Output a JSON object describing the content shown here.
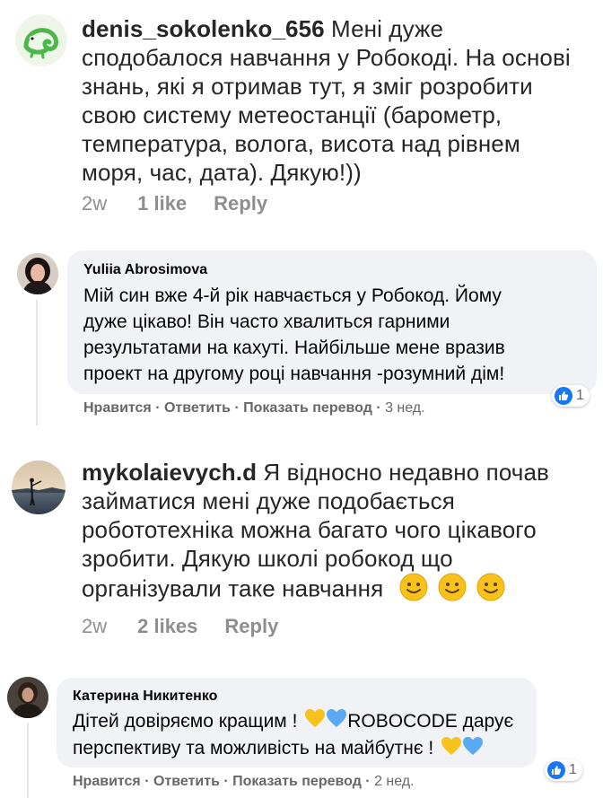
{
  "comments": [
    {
      "username": "denis_sokolenko_656",
      "text_lines": [
        "Мені дуже",
        "сподобалося навчання у Робокоді. На основі",
        "знань, які я отримав тут, я зміг розробити",
        "свою систему метеостанції (барометр,",
        "температура, волога, висота над рівнем",
        "моря, час, дата). Дякую!))"
      ],
      "time": "2w",
      "likes": "1 like",
      "reply": "Reply"
    },
    {
      "name": "Yuliia Abrosimova",
      "text_lines": [
        "Мій син вже 4-й рік навчається у Робокод. Йому",
        "дуже цікаво! Він часто хвалиться гарними",
        "результатами на кахуті. Найбільше мене вразив",
        "проект на другому році навчання -розумний дім!"
      ],
      "actions": "Нравится · Ответить · Показать перевод · ",
      "time": "3 нед.",
      "reaction_count": "1"
    },
    {
      "username": "mykolaievych.d",
      "text_lines": [
        "Я відносно недавно почав",
        "займатися мені дуже подобається",
        "робототехніка можна багато чого цікавого",
        "зробити. Дякую школі робокод що",
        "організували  таке навчання"
      ],
      "time": "2w",
      "likes": "2 likes",
      "reply": "Reply"
    },
    {
      "name": "Катерина Никитенко",
      "text_line1_a": "Дітей довіряємо кращим !",
      "text_line1_b": "ROBOCODE дарує",
      "text_line2": "перспективу та можливість на майбутнє !",
      "actions": "Нравится · Ответить · Показать перевод · ",
      "time": "2 нед.",
      "reaction_count": "1"
    }
  ],
  "icons": {
    "chameleon_avatar": "chameleon-avatar",
    "smiley": "slightly-smiling-face-emoji",
    "yellow_heart": "yellow-heart-emoji",
    "blue_heart": "blue-heart-emoji",
    "like": "thumbs-up-reaction-icon"
  },
  "colors": {
    "fb_bubble": "#f0f2f5",
    "fb_blue": "#1877f2",
    "ig_gray": "#8e8e8e",
    "chameleon_green": "#4cb84a",
    "heart_yellow": "#f7c21e",
    "heart_blue": "#5aa9f5"
  }
}
